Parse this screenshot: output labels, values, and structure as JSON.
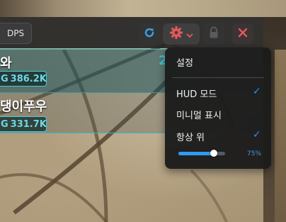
{
  "toolbar": {
    "tab_label": "DPS",
    "icons": {
      "refresh": "refresh-icon",
      "settings": "gear-icon",
      "settings_caret": "chevron-down-icon",
      "lock": "lock-icon",
      "close": "close-icon"
    }
  },
  "rows": [
    {
      "name": "와",
      "rank": "2",
      "damage_prefix": "G",
      "damage": "386.2K"
    },
    {
      "name": "댕이푸우",
      "damage_prefix": "G",
      "damage": "331.7K"
    }
  ],
  "menu": {
    "title": "설정",
    "items": [
      {
        "label": "HUD 모드",
        "checked": true
      },
      {
        "label": "미니멀 표시",
        "checked": false
      },
      {
        "label": "항상 위",
        "checked": true
      }
    ],
    "check_glyph": "✓",
    "opacity": {
      "value": 0.75,
      "label": "75%"
    }
  },
  "colors": {
    "accent_blue": "#2f8ff0",
    "cyan": "#3ec6d6",
    "refresh_icon": "#3aa0e8",
    "settings_icon": "#e4585c",
    "close_icon": "#e4585c"
  }
}
